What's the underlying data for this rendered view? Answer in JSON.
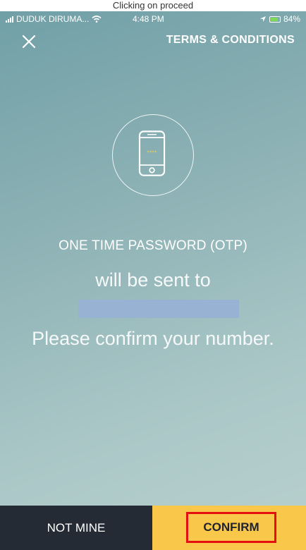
{
  "caption": "Clicking on proceed",
  "status_bar": {
    "carrier": "DUDUK DIRUMA...",
    "time": "4:48 PM",
    "battery": "84%",
    "icons": [
      "signal-icon",
      "wifi-icon",
      "location-icon",
      "battery-icon"
    ]
  },
  "header": {
    "close_icon": "close-icon",
    "terms_label": "TERMS & CONDITIONS"
  },
  "main": {
    "illustration_icon": "phone-otp-icon",
    "otp_stars": "****",
    "otp_title": "ONE TIME PASSWORD (OTP)",
    "sent_to": "will be sent to",
    "confirm_message": "Please confirm your number."
  },
  "footer": {
    "not_mine_label": "NOT MINE",
    "confirm_label": "CONFIRM"
  },
  "colors": {
    "background": "#8fb3b6",
    "confirm_bg": "#f9c74a",
    "not_mine_bg": "#252b34",
    "highlight": "#e50f0f",
    "redaction": "#98b2d4"
  }
}
